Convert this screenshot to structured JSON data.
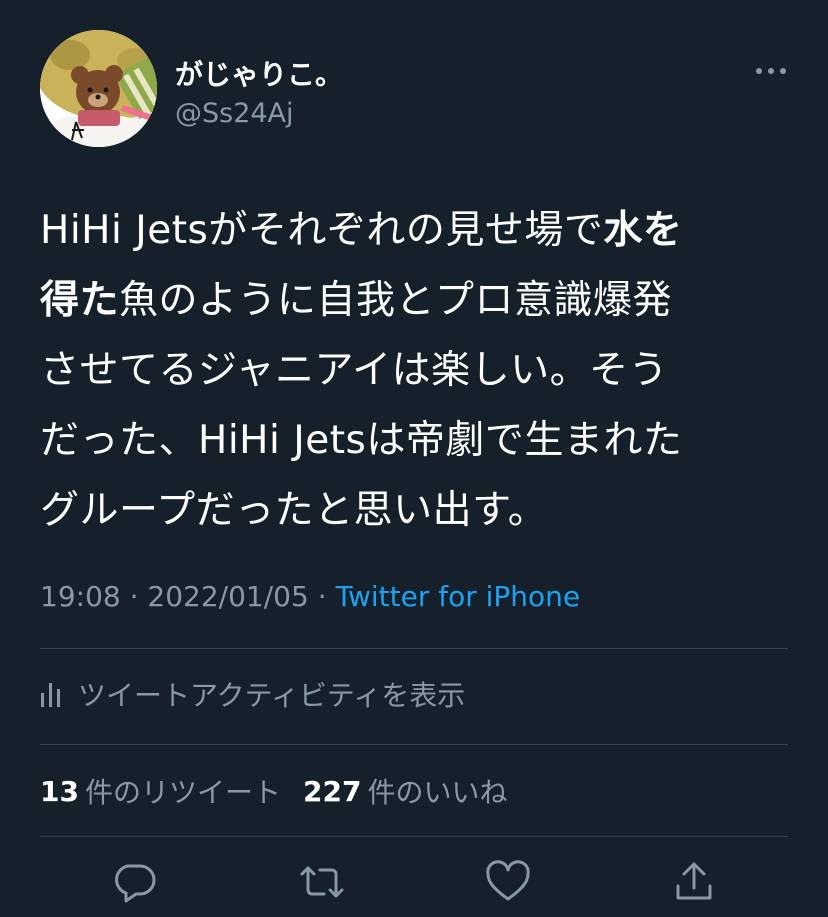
{
  "author": {
    "display_name": "がじゃりこ。",
    "handle": "@Ss24Aj",
    "avatar_icon": "bear-avatar-image",
    "more_icon": "more-options-icon"
  },
  "tweet": {
    "lines": [
      [
        {
          "text": "HiHi Jetsがそれぞれの見せ場で",
          "bold": false
        },
        {
          "text": "水を",
          "bold": true
        }
      ],
      [
        {
          "text": "得た",
          "bold": true
        },
        {
          "text": "魚のように自我とプロ意識爆発",
          "bold": false
        }
      ],
      [
        {
          "text": "させてるジャニアイは楽しい。そう",
          "bold": false
        }
      ],
      [
        {
          "text": "だった、HiHi Jetsは帝劇で生まれた",
          "bold": false
        }
      ],
      [
        {
          "text": "グループだったと思い出す。",
          "bold": false
        }
      ]
    ],
    "time": "19:08",
    "separator": " · ",
    "date": "2022/01/05",
    "source": "Twitter for iPhone"
  },
  "activity": {
    "label": "ツイートアクティビティを表示",
    "icon": "analytics-bars-icon"
  },
  "stats": {
    "retweets_count": "13",
    "retweets_label": "件のリツイート",
    "likes_count": "227",
    "likes_label": "件のいいね"
  },
  "actions": [
    {
      "name": "reply-icon"
    },
    {
      "name": "retweet-icon"
    },
    {
      "name": "like-heart-icon"
    },
    {
      "name": "share-icon"
    }
  ],
  "colors": {
    "background": "#15202b",
    "primary_text": "#ffffff",
    "secondary_text": "#8899a6",
    "link": "#1da1f2",
    "divider": "#38444d"
  }
}
